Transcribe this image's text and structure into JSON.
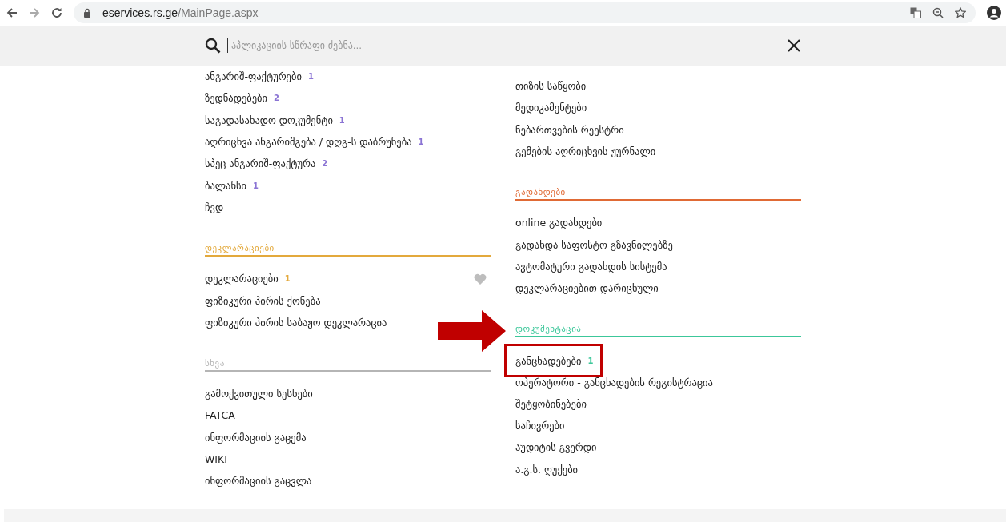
{
  "browser": {
    "url_host": "eservices.rs.ge",
    "url_path": "/MainPage.aspx"
  },
  "search": {
    "placeholder": "აპლიკაციის სწრაფი ძებნა..."
  },
  "columns": [
    {
      "groups": [
        {
          "color": "#8b74d4",
          "items": [
            {
              "label": "ანგარიშ-ფაქტურები",
              "count": "1",
              "favorite": false,
              "highlighted": false
            },
            {
              "label": "ზედნადებები",
              "count": "2",
              "favorite": false,
              "highlighted": false
            },
            {
              "label": "საგადასახადო დოკუმენტი",
              "count": "1",
              "favorite": false,
              "highlighted": false
            },
            {
              "label": "აღრიცხვა ანგარიშგება / დღგ-ს დაბრუნება",
              "count": "1",
              "favorite": false,
              "highlighted": false
            },
            {
              "label": "სპეც ანგარიშ-ფაქტურა",
              "count": "2",
              "favorite": false,
              "highlighted": false
            },
            {
              "label": "ბალანსი",
              "count": "1",
              "favorite": false,
              "highlighted": false
            },
            {
              "label": "ჩვდ",
              "favorite": false,
              "highlighted": false
            }
          ]
        },
        {
          "title": "დეკლარაციები",
          "color": "#e3a93c",
          "items": [
            {
              "label": "დეკლარაციები",
              "count": "1",
              "favorite": true,
              "highlighted": false
            },
            {
              "label": "ფიზიკური პირის ქონება",
              "favorite": false,
              "highlighted": false
            },
            {
              "label": "ფიზიკური პირის საბაჟო დეკლარაცია",
              "favorite": false,
              "highlighted": false
            }
          ]
        },
        {
          "title": "სხვა",
          "color": "#b5b5b5",
          "items": [
            {
              "label": "გამოქვითული სესხები",
              "favorite": false,
              "highlighted": false
            },
            {
              "label": "FATCA",
              "favorite": false,
              "highlighted": false
            },
            {
              "label": "ინფორმაციის გაცემა",
              "favorite": false,
              "highlighted": false
            },
            {
              "label": "WIKI",
              "favorite": false,
              "highlighted": false
            },
            {
              "label": "ინფორმაციის გაცვლა",
              "favorite": false,
              "highlighted": false
            }
          ]
        }
      ]
    },
    {
      "groups": [
        {
          "items": [
            {
              "label": "თიზის საწყობი",
              "favorite": false,
              "highlighted": false
            },
            {
              "label": "მედიკამენტები",
              "favorite": false,
              "highlighted": false
            },
            {
              "label": "ნებართვების რეესტრი",
              "favorite": false,
              "highlighted": false
            },
            {
              "label": "გემების აღრიცხვის ჟურნალი",
              "favorite": false,
              "highlighted": false
            }
          ]
        },
        {
          "title": "გადახდები",
          "color": "#e06a35",
          "items": [
            {
              "label": "online გადახდები",
              "favorite": false,
              "highlighted": false
            },
            {
              "label": "გადახდა საფოსტო გზავნილებზე",
              "favorite": false,
              "highlighted": false
            },
            {
              "label": "ავტომატური გადახდის სისტემა",
              "favorite": false,
              "highlighted": false
            },
            {
              "label": "დეკლარაციებით დარიცხული",
              "favorite": false,
              "highlighted": false
            }
          ]
        },
        {
          "title": "დოკუმენტაცია",
          "color": "#3cc79a",
          "pointer": true,
          "items": [
            {
              "label": "განცხადებები",
              "count": "1",
              "favorite": false,
              "highlighted": true
            },
            {
              "label": "ოპერატორი - განცხადების რეგისტრაცია",
              "favorite": false,
              "highlighted": false
            },
            {
              "label": "შეტყობინებები",
              "favorite": false,
              "highlighted": false
            },
            {
              "label": "საჩივრები",
              "favorite": false,
              "highlighted": false
            },
            {
              "label": "აუდიტის გვერდი",
              "favorite": false,
              "highlighted": false
            },
            {
              "label": "ა.გ.ს. ღუქები",
              "favorite": false,
              "highlighted": false
            }
          ]
        }
      ]
    }
  ]
}
